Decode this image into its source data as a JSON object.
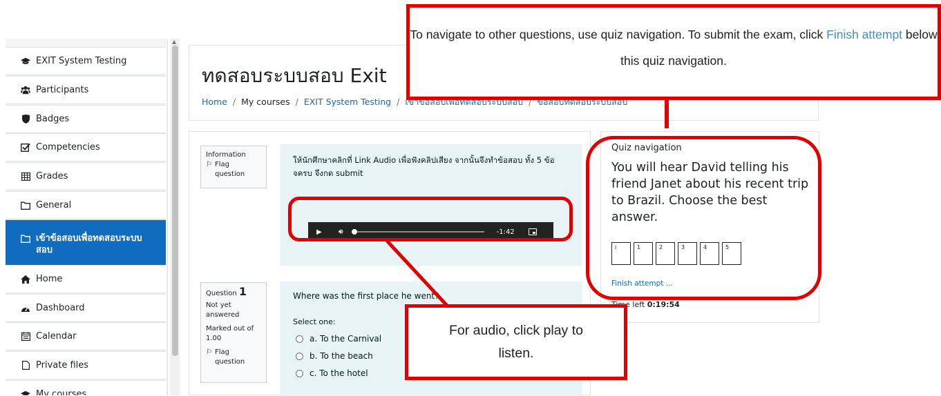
{
  "sidebar": {
    "items": [
      {
        "label": "EXIT System Testing",
        "icon": "graduation-cap-icon"
      },
      {
        "label": "Participants",
        "icon": "users-icon"
      },
      {
        "label": "Badges",
        "icon": "shield-icon"
      },
      {
        "label": "Competencies",
        "icon": "check-square-icon"
      },
      {
        "label": "Grades",
        "icon": "table-icon"
      },
      {
        "label": "General",
        "icon": "folder-icon"
      },
      {
        "label": "เข้าข้อสอบเพื่อทดสอบระบบสอบ",
        "icon": "folder-icon"
      },
      {
        "label": "Home",
        "icon": "home-icon"
      },
      {
        "label": "Dashboard",
        "icon": "dashboard-icon"
      },
      {
        "label": "Calendar",
        "icon": "calendar-icon"
      },
      {
        "label": "Private files",
        "icon": "file-icon"
      },
      {
        "label": "My courses",
        "icon": "graduation-cap-icon"
      }
    ]
  },
  "header": {
    "title": "ทดสอบระบบสอบ Exit",
    "breadcrumb": [
      "Home",
      "My courses",
      "EXIT System Testing",
      "เข้าข้อสอบเพื่อทดสอบระบบสอบ",
      "ข้อสอบทดสอบระบบสอบ"
    ]
  },
  "information": {
    "label": "Information",
    "flag": "Flag question",
    "text": "ให้นักศึกษาคลิกที่ Link Audio เพื่อฟังคลิปเสียง จากนั้นจึงทำข้อสอบ ทั้ง 5 ข้อ จครบ จึงกด submit",
    "audio_time": "-1:42"
  },
  "question": {
    "label": "Question",
    "number": "1",
    "status": "Not yet answered",
    "marked": "Marked out of 1.00",
    "flag": "Flag question",
    "text": "Where was the first place he went?",
    "select_label": "Select one:",
    "options": [
      "a. To the Carnival",
      "b. To the beach",
      "c. To the hotel"
    ]
  },
  "quiz_nav": {
    "heading": "Quiz navigation",
    "description": "You will hear David telling his friend Janet about his recent trip to Brazil. Choose the best answer.",
    "buttons": [
      "i",
      "1",
      "2",
      "3",
      "4",
      "5"
    ],
    "finish": "Finish attempt ...",
    "time_label": "Time left",
    "time_value": "0:19:54"
  },
  "annotations": {
    "top_pre": "To navigate to other questions, use quiz navigation. To submit the exam, click ",
    "top_link": "Finish attempt",
    "top_post": " below this quiz navigation.",
    "audio_note": "For audio, click play to listen."
  },
  "colors": {
    "accent": "#0f6cbf",
    "annotation": "#e00000",
    "content_bg": "#e7f3f5"
  }
}
